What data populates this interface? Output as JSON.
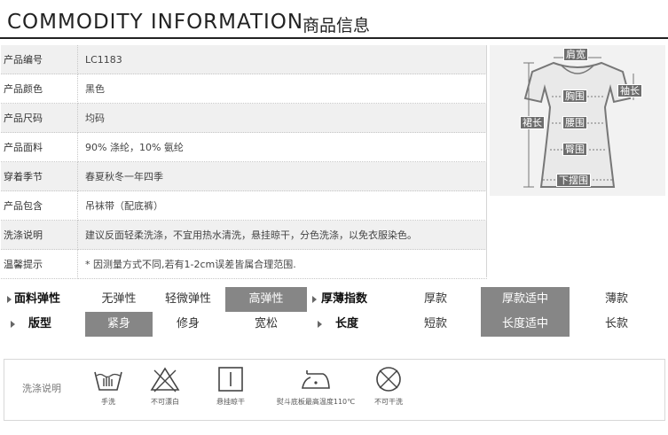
{
  "header": {
    "title_en": "COMMODITY INFORMATION",
    "title_zh": "商品信息"
  },
  "info_rows": [
    {
      "key": "产品编号",
      "value": "LC1183"
    },
    {
      "key": "产品颜色",
      "value": "黑色"
    },
    {
      "key": "产品尺码",
      "value": "均码"
    },
    {
      "key": "产品面料",
      "value": "90% 涤纶，10% 氨纶"
    },
    {
      "key": "穿着季节",
      "value": "春夏秋冬一年四季"
    },
    {
      "key": "产品包含",
      "value": "吊袜带（配底裤）"
    },
    {
      "key": "洗涤说明",
      "value": "建议反面轻柔洗涤，不宜用热水清洗，悬挂晾干，分色洗涤，以免衣服染色。"
    },
    {
      "key": "温馨提示",
      "value": "* 因测量方式不同,若有1-2cm误差皆属合理范围."
    }
  ],
  "measure_labels": {
    "shoulder": "肩宽",
    "sleeve": "袖长",
    "chest": "胸围",
    "length": "裙长",
    "waist": "腰围",
    "hip": "臀围",
    "hem": "下摆围"
  },
  "attributes": {
    "row1": {
      "left_label": "面料弹性",
      "left_options": [
        "无弹性",
        "轻微弹性",
        "高弹性"
      ],
      "left_selected": "高弹性",
      "right_label": "厚薄指数",
      "right_options": [
        "厚款",
        "厚款适中",
        "薄款"
      ],
      "right_selected": "厚款适中"
    },
    "row2": {
      "left_label": "版型",
      "left_options": [
        "紧身",
        "修身",
        "宽松"
      ],
      "left_selected": "紧身",
      "right_label": "长度",
      "right_options": [
        "短款",
        "长度适中",
        "长款"
      ],
      "right_selected": "长度适中"
    }
  },
  "care": {
    "title": "洗涤说明",
    "items": [
      {
        "icon": "hand-wash-icon",
        "caption": "手洗"
      },
      {
        "icon": "no-bleach-icon",
        "caption": "不可漂白"
      },
      {
        "icon": "hang-dry-icon",
        "caption": "悬挂晾干"
      },
      {
        "icon": "iron-icon",
        "caption": "熨斗底板最高温度110℃"
      },
      {
        "icon": "no-dry-clean-icon",
        "caption": "不可干洗"
      }
    ]
  }
}
